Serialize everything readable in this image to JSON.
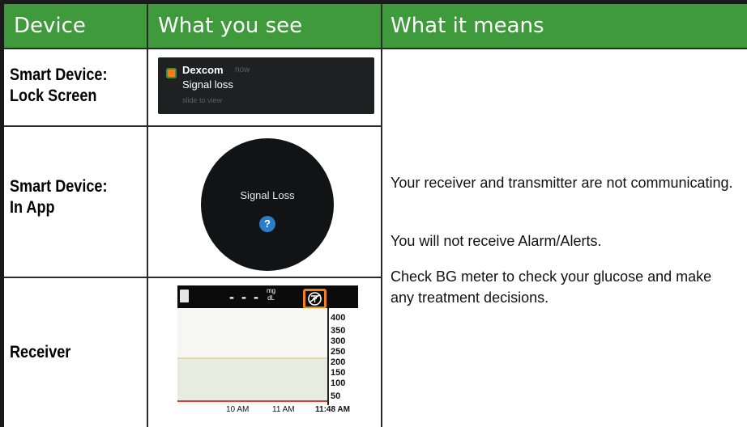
{
  "header": {
    "col1": "Device",
    "col2": "What you see",
    "col3": "What it means"
  },
  "rows": [
    {
      "device_line1": "Smart Device:",
      "device_line2": "Lock Screen"
    },
    {
      "device_line1": "Smart Device:",
      "device_line2": "In App"
    },
    {
      "device_line1": "Receiver"
    }
  ],
  "lock_screen": {
    "app_name": "Dexcom",
    "time": "now",
    "message": "Signal loss",
    "hint": "slide to view",
    "icon": "dexcom-app-icon"
  },
  "in_app": {
    "message": "Signal Loss",
    "help_glyph": "?",
    "icon": "help-icon"
  },
  "receiver": {
    "reading": "- - -",
    "unit_top": "mg",
    "unit_bottom": "dL",
    "y_ticks": [
      "400",
      "350",
      "300",
      "250",
      "200",
      "150",
      "100",
      "50"
    ],
    "x_ticks": [
      "10 AM",
      "11 AM",
      "11:48 AM"
    ],
    "high_target": 200,
    "low_target": 70,
    "icons": [
      "battery-icon",
      "signal-loss-icon"
    ]
  },
  "meaning": {
    "p1": "Your receiver and transmitter are not communicating.",
    "p2": "You will not receive Alarm/Alerts.",
    "p3": "Check BG meter to check your glucose and make any treatment decisions."
  },
  "colors": {
    "header_bg": "#3f9a3c",
    "highlight": "#f0821e"
  }
}
